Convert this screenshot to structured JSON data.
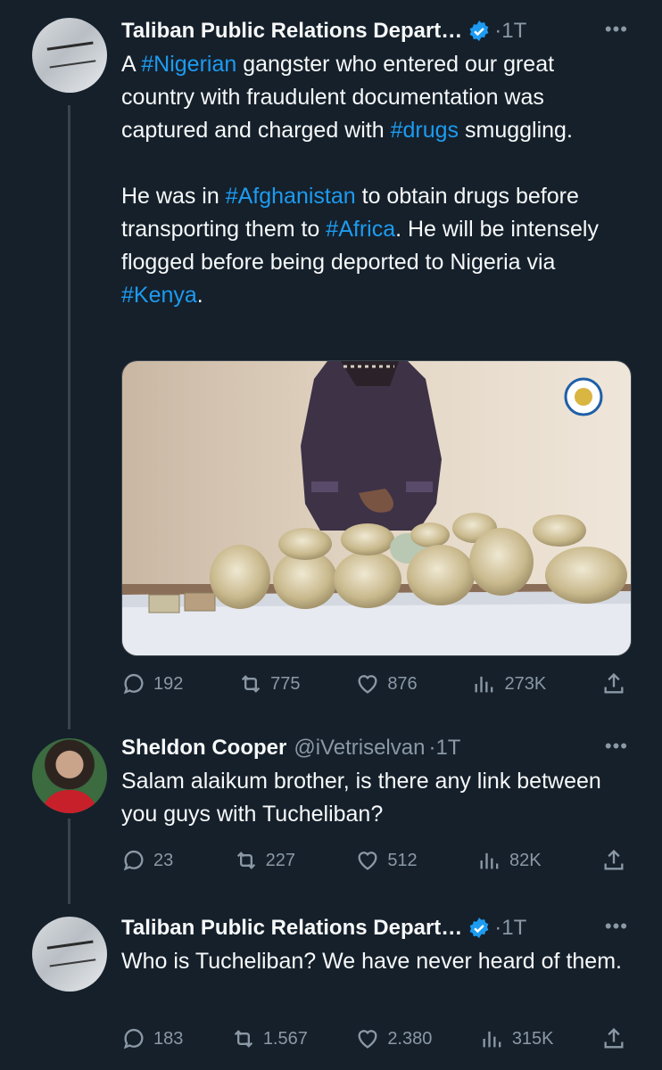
{
  "colors": {
    "background": "#15202b",
    "text": "#f7f9f9",
    "muted": "#8b98a5",
    "link": "#1d9bf0",
    "verified": "#1d9bf0"
  },
  "tweet1": {
    "author": "Taliban Public Relations Depart…",
    "dot": "·",
    "time": "1T",
    "more": "•••",
    "p1": {
      "a": "A ",
      "t1": "#Nigerian",
      "b": " gangster who entered our great country with fraudulent documentation was captured and charged with ",
      "t2": "#drugs",
      "c": " smuggling."
    },
    "p2": {
      "a": "He was in ",
      "t1": "#Afghanistan",
      "b": " to obtain drugs before transporting them to ",
      "t2": "#Africa",
      "c": ". He will be intensely flogged before being deported to Nigeria via ",
      "t3": "#Kenya",
      "d": "."
    },
    "stats": {
      "replies": "192",
      "retweets": "775",
      "likes": "876",
      "views": "273K"
    }
  },
  "tweet2": {
    "author": "Sheldon Cooper",
    "handle": "@iVetriselvan",
    "dot": "·",
    "time": "1T",
    "more": "•••",
    "text": "Salam alaikum brother, is there any link between you guys with Tucheliban?",
    "stats": {
      "replies": "23",
      "retweets": "227",
      "likes": "512",
      "views": "82K"
    }
  },
  "tweet3": {
    "author": "Taliban Public Relations Depart…",
    "dot": "·",
    "time": "1T",
    "more": "•••",
    "text": "Who is Tucheliban? We have never heard of them.",
    "stats": {
      "replies": "183",
      "retweets": "1.567",
      "likes": "2.380",
      "views": "315K"
    }
  },
  "icons": [
    "reply-icon",
    "retweet-icon",
    "like-icon",
    "views-icon",
    "share-icon",
    "verified-icon",
    "more-icon"
  ]
}
